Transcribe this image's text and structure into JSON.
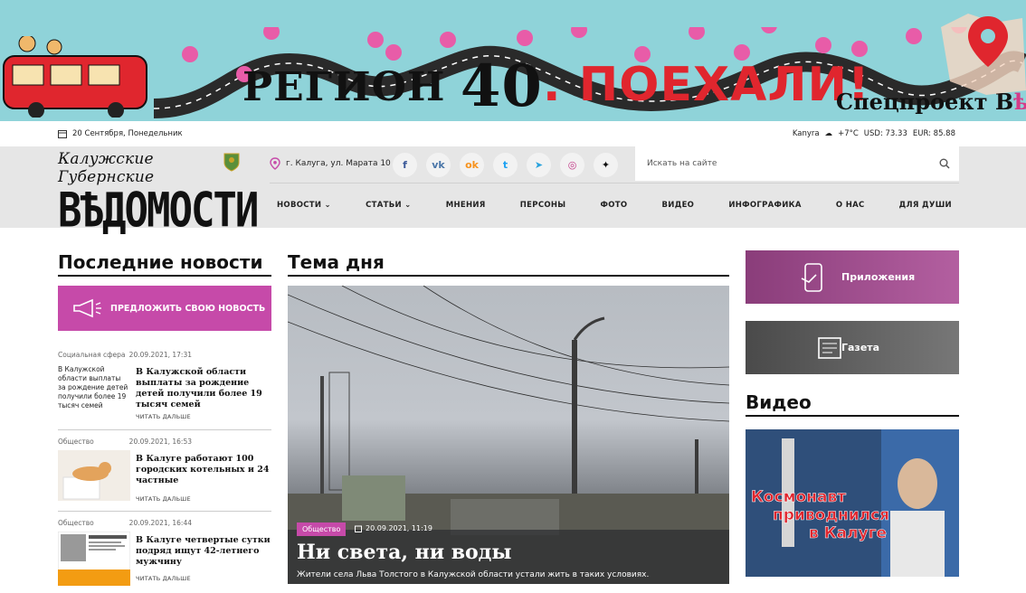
{
  "banner": {
    "title_part1": "РЕГИОН",
    "title_num": "40",
    "title_part2": ". ПОЕХАЛИ!",
    "special_text": "Спецпроект ",
    "special_logo": "В"
  },
  "infobar": {
    "date": "20 Сентября, Понедельник",
    "city": "Kanyra",
    "temp": "+7°C",
    "usd": "USD: 73.33",
    "eur": "EUR: 85.88"
  },
  "header": {
    "logo_small": "Калужские Губернские",
    "logo_big": "ВѢДОМОСТИ",
    "address": "г. Калуга, ул. Марата 10",
    "search_placeholder": "Искать на сайте",
    "socials": [
      {
        "name": "facebook-icon",
        "glyph": "f",
        "color": "#3b5998"
      },
      {
        "name": "vk-icon",
        "glyph": "vk",
        "color": "#4a76a8"
      },
      {
        "name": "odnoklassniki-icon",
        "glyph": "ok",
        "color": "#f7931e"
      },
      {
        "name": "twitter-icon",
        "glyph": "t",
        "color": "#1da1f2"
      },
      {
        "name": "telegram-icon",
        "glyph": "➤",
        "color": "#2aa3dd"
      },
      {
        "name": "instagram-icon",
        "glyph": "◎",
        "color": "#c13584"
      },
      {
        "name": "zen-icon",
        "glyph": "✦",
        "color": "#111"
      }
    ],
    "nav": [
      "НОВОСТИ ⌄",
      "СТАТЬИ ⌄",
      "МНЕНИЯ",
      "ПЕРСОНЫ",
      "ФОТО",
      "ВИДЕО",
      "ИНФОГРАФИКА",
      "О НАС",
      "ДЛЯ ДУШИ"
    ]
  },
  "left": {
    "title": "Последние новости",
    "suggest_label": "ПРЕДЛОЖИТЬ СВОЮ НОВОСТЬ",
    "items": [
      {
        "category": "Социальная сфера",
        "date": "20.09.2021, 17:31",
        "thumb_text": "В Калужской области выплаты за рождение детей получили более 19 тысяч семей",
        "headline": "В Калужской области выплаты за рождение детей получили более 19 тысяч семей",
        "more": "ЧИТАТЬ ДАЛЬШЕ"
      },
      {
        "category": "Общество",
        "date": "20.09.2021, 16:53",
        "headline": "В Калуге работают 100 городских котельных и 24 частные",
        "more": "ЧИТАТЬ ДАЛЬШЕ"
      },
      {
        "category": "Общество",
        "date": "20.09.2021, 16:44",
        "headline": "В Калуге четвертые сутки подряд ищут 42-летнего мужчину",
        "more": "ЧИТАТЬ ДАЛЬШЕ"
      }
    ]
  },
  "center": {
    "title": "Тема дня",
    "tag": "Общество",
    "date": "20.09.2021, 11:19",
    "headline": "Ни света, ни воды",
    "sub": "Жители села Льва Толстого в Калужской области устали жить в таких условиях."
  },
  "right": {
    "apps_label": "Приложения",
    "gazeta_label": "Газета",
    "video_title": "Видео",
    "video_caption": "Космонавт приводнился в Калуге"
  }
}
